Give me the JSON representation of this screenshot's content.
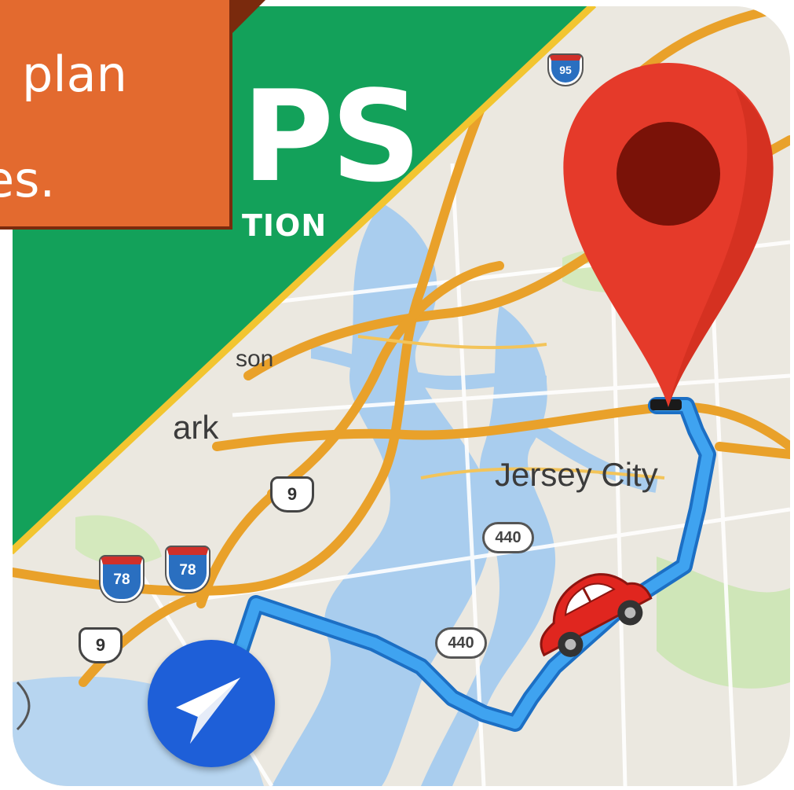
{
  "app_icon": {
    "brand_letters": "PS",
    "brand_subtitle": "TION"
  },
  "banner": {
    "line1": "plan",
    "line2": "es."
  },
  "map": {
    "labels": {
      "city_main": "Jersey City",
      "city_partial_left": "ark",
      "area_partial": "son"
    },
    "shields": {
      "interstate_top": "95",
      "interstate_78a": "78",
      "interstate_78b": "78",
      "us_9_upper": "9",
      "us_9_lower": "9",
      "route_440_upper": "440",
      "route_440_lower": "440"
    }
  },
  "colors": {
    "green_panel": "#13a15a",
    "gold_border": "#f2c530",
    "route_blue": "#2f93e6",
    "pin_red": "#e53a2a",
    "pin_center": "#7a1208",
    "nav_button_blue": "#1e5fd8",
    "car_red": "#e0261f",
    "banner_orange": "#e36a2f",
    "water_blue": "#a9cdee",
    "highway_orange": "#e9a12a"
  },
  "icons": [
    "destination-pin-icon",
    "car-icon",
    "navigation-arrow-icon"
  ]
}
